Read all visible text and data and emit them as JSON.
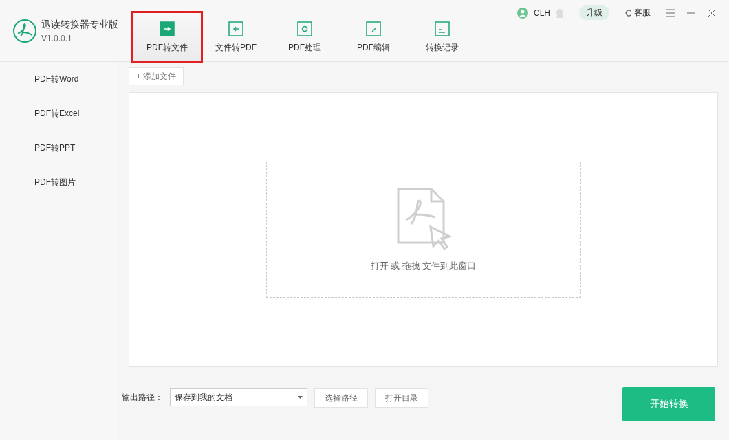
{
  "app": {
    "name": "迅读转换器专业版",
    "version": "V1.0.0.1"
  },
  "tabs": [
    {
      "label": "PDF转文件",
      "selected": true,
      "highlighted": true
    },
    {
      "label": "文件转PDF",
      "selected": false,
      "highlighted": false
    },
    {
      "label": "PDF处理",
      "selected": false,
      "highlighted": false
    },
    {
      "label": "PDF编辑",
      "selected": false,
      "highlighted": false
    },
    {
      "label": "转换记录",
      "selected": false,
      "highlighted": false
    }
  ],
  "user": {
    "name": "CLH",
    "upgrade": "升级",
    "service": "客服"
  },
  "sidebar": {
    "items": [
      {
        "label": "PDF转Word",
        "selected": false
      },
      {
        "label": "PDF转Excel",
        "selected": false
      },
      {
        "label": "PDF转PPT",
        "selected": false
      },
      {
        "label": "PDF转图片",
        "selected": false
      }
    ]
  },
  "add_file": "+ 添加文件",
  "drop_zone": {
    "hint": "打开 或 拖拽 文件到此窗口"
  },
  "output": {
    "label": "输出路径：",
    "value": "保存到我的文档",
    "choose": "选择路径",
    "open": "打开目录"
  },
  "start_button": "开始转换"
}
